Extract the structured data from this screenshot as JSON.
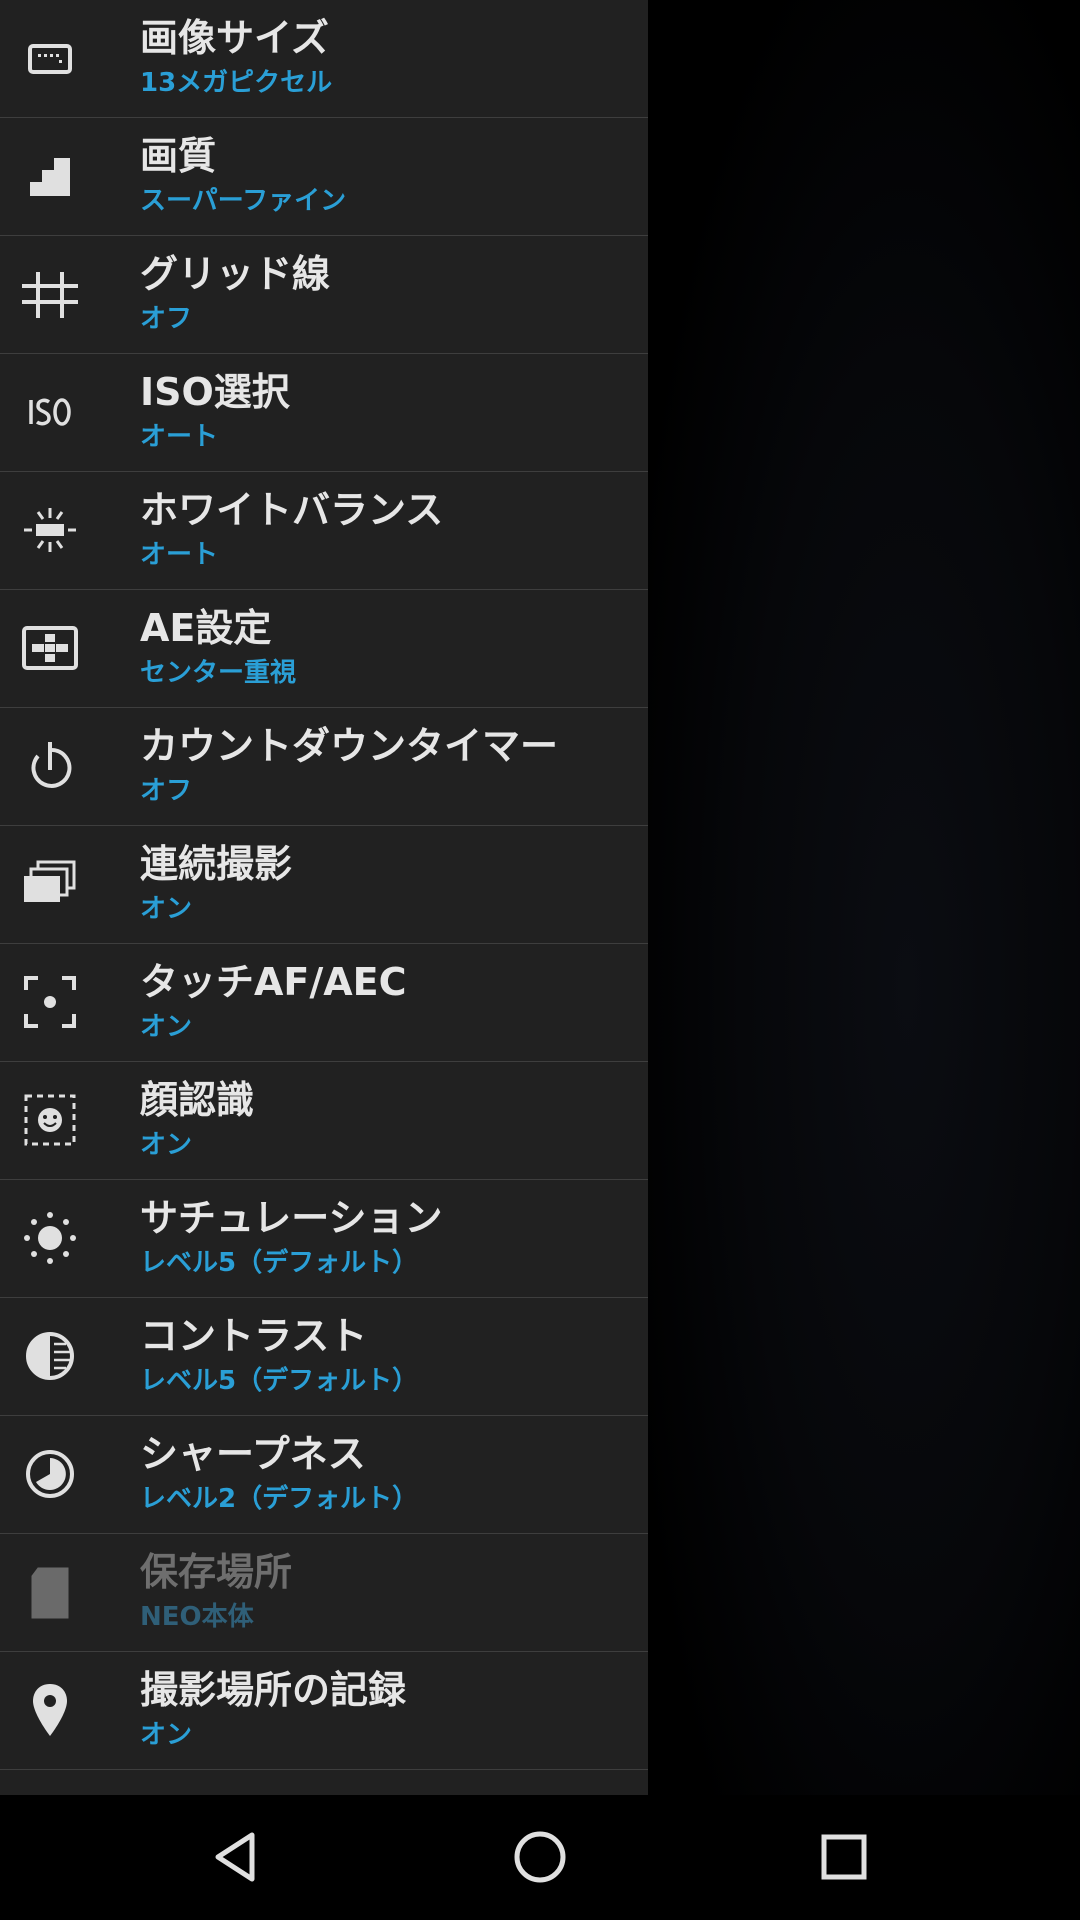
{
  "settings": {
    "items": [
      {
        "title": "画像サイズ",
        "value": "13メガピクセル",
        "icon": "image-size-icon"
      },
      {
        "title": "画質",
        "value": "スーパーファイン",
        "icon": "quality-steps-icon"
      },
      {
        "title": "グリッド線",
        "value": "オフ",
        "icon": "grid-icon"
      },
      {
        "title": "ISO選択",
        "value": "オート",
        "icon": "iso-icon"
      },
      {
        "title": "ホワイトバランス",
        "value": "オート",
        "icon": "white-balance-icon"
      },
      {
        "title": "AE設定",
        "value": "センター重視",
        "icon": "metering-icon"
      },
      {
        "title": "カウントダウンタイマー",
        "value": "オフ",
        "icon": "timer-icon"
      },
      {
        "title": "連続撮影",
        "value": "オン",
        "icon": "burst-icon"
      },
      {
        "title": "タッチAF/AEC",
        "value": "オン",
        "icon": "touch-focus-icon"
      },
      {
        "title": "顔認識",
        "value": "オン",
        "icon": "face-detection-icon"
      },
      {
        "title": "サチュレーション",
        "value": "レベル5（デフォルト）",
        "icon": "saturation-icon"
      },
      {
        "title": "コントラスト",
        "value": "レベル5（デフォルト）",
        "icon": "contrast-icon"
      },
      {
        "title": "シャープネス",
        "value": "レベル2（デフォルト）",
        "icon": "sharpness-icon"
      },
      {
        "title": "保存場所",
        "value": "NEO本体",
        "icon": "sd-card-icon",
        "disabled": true
      },
      {
        "title": "撮影場所の記録",
        "value": "オン",
        "icon": "location-pin-icon"
      }
    ]
  },
  "navbar": {
    "back": "back-icon",
    "home": "home-icon",
    "recents": "recents-icon"
  },
  "colors": {
    "panel": "#212121",
    "accent": "#2a9fd6",
    "title": "#e6e6e6",
    "divider": "#3e3e3e"
  }
}
